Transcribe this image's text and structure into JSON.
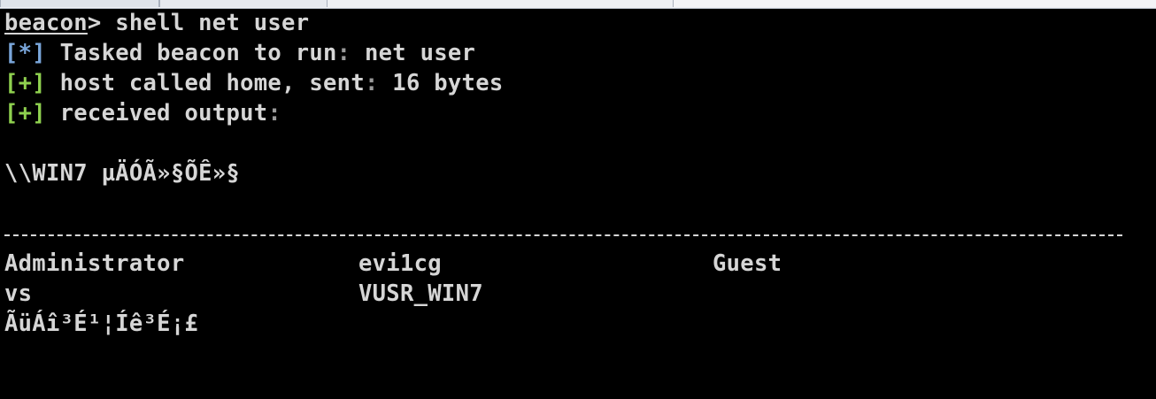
{
  "prompt": {
    "name": "beacon",
    "symbol": "> ",
    "command": "shell net user"
  },
  "messages": [
    {
      "marker": "[*]",
      "label": " Tasked beacon to run",
      "sep": ":",
      "value": " net user"
    },
    {
      "marker": "[+]",
      "label": " host called home, sent",
      "sep": ":",
      "value": " 16 bytes"
    },
    {
      "marker": "[+]",
      "label": " received output",
      "sep": ":",
      "value": ""
    }
  ],
  "output": {
    "header": "\\\\WIN7 µÄÓÃ»§ÕÊ»§",
    "accounts": [
      [
        "Administrator",
        "evi1cg",
        "Guest"
      ],
      [
        "vs",
        "VUSR_WIN7",
        ""
      ]
    ],
    "footer": "ÃüÁî³É¹¦Íê³É¡£"
  },
  "colors": {
    "background": "#000000",
    "text": "#d6d6d6",
    "info_marker": "#7aa6da",
    "ok_marker": "#8fd14f",
    "punctuation": "#9a9a9a"
  }
}
